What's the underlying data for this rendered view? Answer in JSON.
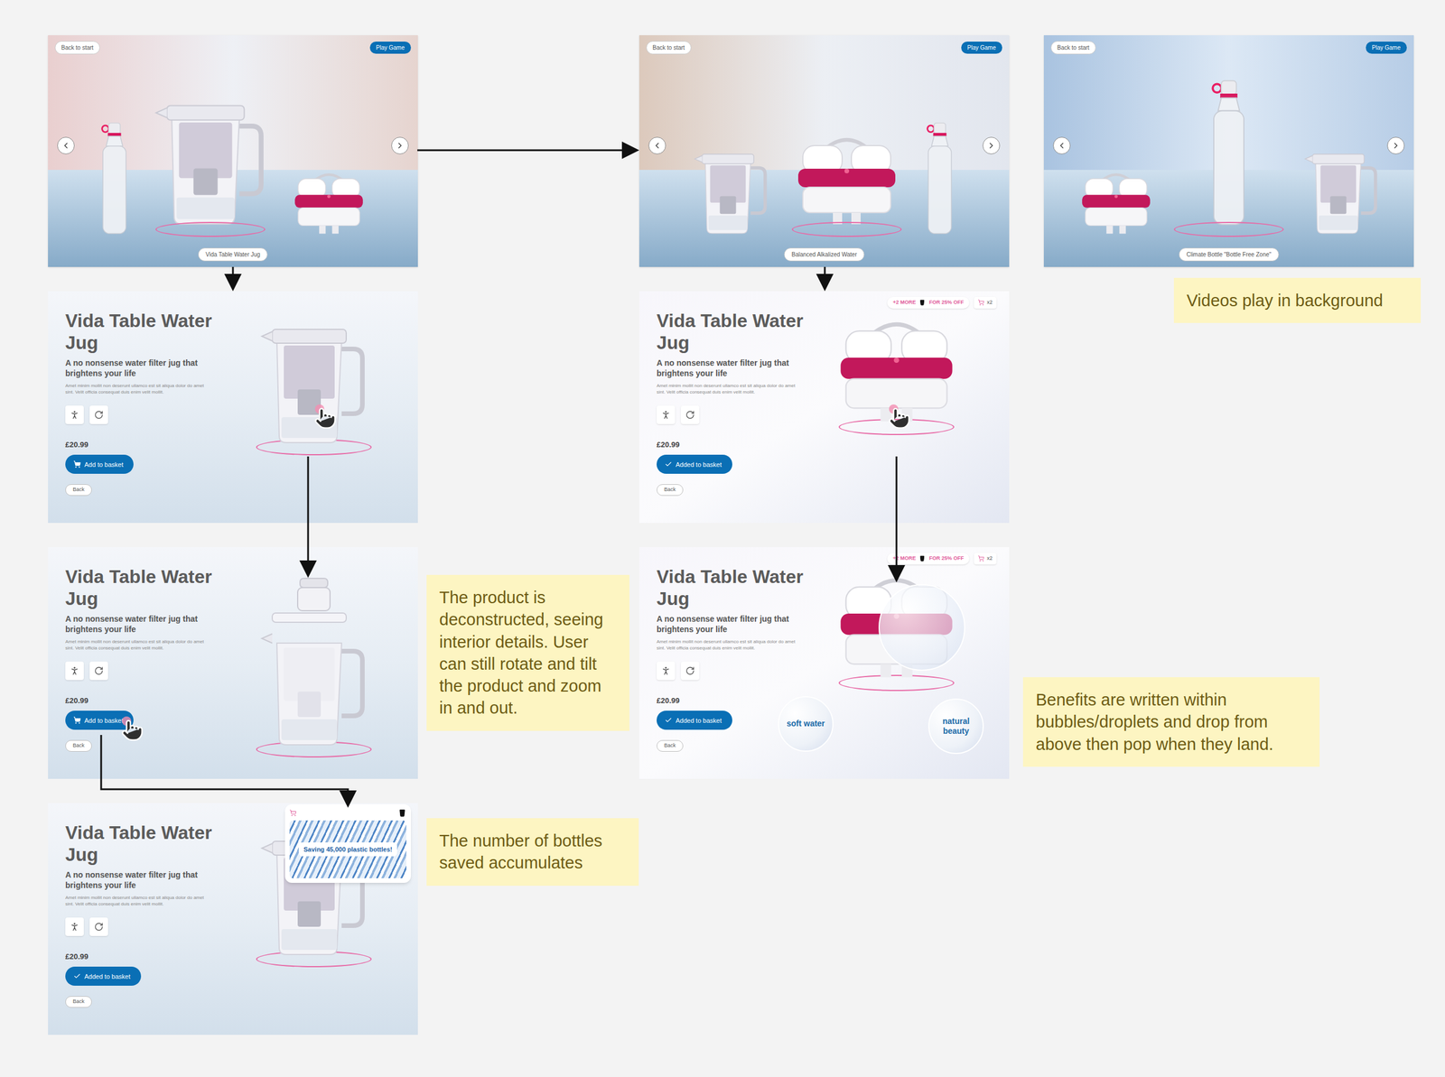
{
  "carousel": [
    {
      "scene": "people",
      "back": "Back to start",
      "play": "Play Game",
      "caption": "Vida Table Water Jug",
      "products": [
        {
          "kind": "bottle",
          "selected": false
        },
        {
          "kind": "jug",
          "selected": true
        },
        {
          "kind": "filter",
          "selected": false
        }
      ]
    },
    {
      "scene": "boy",
      "back": "Back to start",
      "play": "Play Game",
      "caption": "Balanced Alkalized Water",
      "products": [
        {
          "kind": "jug",
          "selected": false
        },
        {
          "kind": "filter",
          "selected": true
        },
        {
          "kind": "bottle",
          "selected": false
        }
      ]
    },
    {
      "scene": "bottles",
      "back": "Back to start",
      "play": "Play Game",
      "caption": "Climate Bottle \"Bottle Free Zone\"",
      "products": [
        {
          "kind": "filter",
          "selected": false
        },
        {
          "kind": "bottle",
          "selected": true
        },
        {
          "kind": "jug",
          "selected": false
        }
      ]
    }
  ],
  "details": [
    {
      "title": "Vida Table Water Jug",
      "subtitle": "A no nonsense water filter jug that brightens your life",
      "body": "Amet minim mollit non deserunt ullamco est sit aliqua dolor do amet sint. Velit officia consequat duis enim velit mollit.",
      "price": "£20.99",
      "basket": {
        "label": "Add to basket",
        "added": false
      },
      "back": "Back",
      "product": "jug",
      "view": "assembled",
      "tap": "product"
    },
    {
      "title": "Vida Table Water Jug",
      "subtitle": "A no nonsense water filter jug that brightens your life",
      "body": "Amet minim mollit non deserunt ullamco est sit aliqua dolor do amet sint. Velit officia consequat duis enim velit mollit.",
      "price": "£20.99",
      "basket": {
        "label": "Add to basket",
        "added": false
      },
      "back": "Back",
      "product": "jug",
      "view": "deconstructed",
      "tap": "button"
    },
    {
      "title": "Vida Table Water Jug",
      "subtitle": "A no nonsense water filter jug that brightens your life",
      "body": "Amet minim mollit non deserunt ullamco est sit aliqua dolor do amet sint. Velit officia consequat duis enim velit mollit.",
      "price": "£20.99",
      "basket": {
        "label": "Added to basket",
        "added": true
      },
      "back": "Back",
      "product": "jug",
      "view": "assembled",
      "tap": "none",
      "popup": {
        "text": "Saving 45,000 plastic bottles!"
      }
    },
    {
      "title": "Vida Table Water Jug",
      "subtitle": "A no nonsense water filter jug that brightens your life",
      "body": "Amet minim mollit non deserunt ullamco est sit aliqua dolor do amet sint. Velit officia consequat duis enim velit mollit.",
      "price": "£20.99",
      "basket": {
        "label": "Added to basket",
        "added": true
      },
      "back": "Back",
      "product": "filter",
      "view": "assembled",
      "tap": "product",
      "offer": {
        "more": "+2 MORE",
        "off": "FOR 25% OFF",
        "count": "x2"
      }
    },
    {
      "title": "Vida Table Water Jug",
      "subtitle": "A no nonsense water filter jug that brightens your life",
      "body": "Amet minim mollit non deserunt ullamco est sit aliqua dolor do amet sint. Velit officia consequat duis enim velit mollit.",
      "price": "£20.99",
      "basket": {
        "label": "Added to basket",
        "added": true
      },
      "back": "Back",
      "product": "filter",
      "view": "assembled",
      "tap": "none",
      "offer": {
        "more": "+2 MORE",
        "off": "FOR 25% OFF",
        "count": "x2"
      },
      "bubbles": [
        "soft water",
        "natural beauty"
      ]
    }
  ],
  "notes": [
    {
      "text": "Videos play in background"
    },
    {
      "text": "The product is deconstructed, seeing interior details. User can still rotate and tilt the product and zoom in and out."
    },
    {
      "text": "The number of bottles saved accumulates"
    },
    {
      "text": "Benefits are written within bubbles/droplets and drop from above then pop when they land."
    }
  ]
}
